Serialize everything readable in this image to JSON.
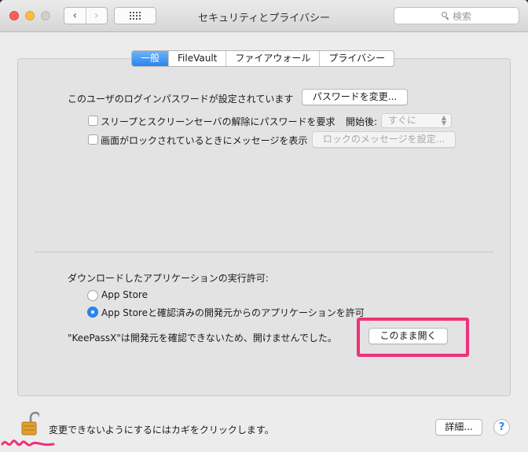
{
  "window": {
    "title": "セキュリティとプライバシー",
    "nav_back": "‹",
    "nav_forward": "›",
    "search_placeholder": "検索"
  },
  "tabs": [
    {
      "label": "一般",
      "active": true
    },
    {
      "label": "FileVault",
      "active": false
    },
    {
      "label": "ファイアウォール",
      "active": false
    },
    {
      "label": "プライバシー",
      "active": false
    }
  ],
  "general": {
    "login_password_text": "このユーザのログインパスワードが設定されています",
    "change_password_button": "パスワードを変更...",
    "require_password_label": "スリープとスクリーンセーバの解除にパスワードを要求",
    "after_label": "開始後:",
    "after_value": "すぐに",
    "lock_message_label": "画面がロックされているときにメッセージを表示",
    "set_lock_message_button": "ロックのメッセージを設定..."
  },
  "downloads": {
    "heading": "ダウンロードしたアプリケーションの実行許可:",
    "options": [
      {
        "label": "App Store",
        "selected": false
      },
      {
        "label": "App Storeと確認済みの開発元からのアプリケーションを許可",
        "selected": true
      }
    ],
    "blocked_message": "\"KeePassX\"は開発元を確認できないため、開けませんでした。",
    "open_anyway_button": "このまま開く"
  },
  "footer": {
    "lock_text": "変更できないようにするにはカギをクリックします。",
    "advanced_button": "詳細...",
    "help_label": "?"
  },
  "colors": {
    "accent": "#2b84ec",
    "highlight": "#f0307a"
  }
}
